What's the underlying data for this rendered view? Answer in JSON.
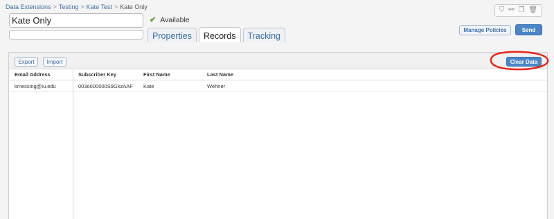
{
  "breadcrumb": {
    "items": [
      "Data Extensions",
      "Testing",
      "Kate Test"
    ],
    "current": "Kate Only",
    "separator": ">"
  },
  "name_value": "Kate Only",
  "description_value": "",
  "status": {
    "label": "Available",
    "color": "#5b9b2b"
  },
  "tabs": [
    {
      "label": "Properties",
      "active": false
    },
    {
      "label": "Records",
      "active": true
    },
    {
      "label": "Tracking",
      "active": false
    }
  ],
  "toolbar_icons": [
    "filter-icon",
    "link-icon",
    "copy-icon",
    "trash-icon"
  ],
  "buttons": {
    "manage_policies": "Manage Policies",
    "send": "Send",
    "export": "Export",
    "import": "Import",
    "clear_data": "Clear Data"
  },
  "grid": {
    "columns": [
      "Email Address",
      "Subscriber Key",
      "First Name",
      "Last Name"
    ],
    "rows": [
      [
        "kmessing@iu.edu",
        "003o000000S9GkzAAF",
        "Kate",
        "Wehner"
      ]
    ]
  },
  "colors": {
    "link": "#3e6fa8",
    "primary_button": "#4a86c7",
    "annotation": "#e8261b"
  }
}
